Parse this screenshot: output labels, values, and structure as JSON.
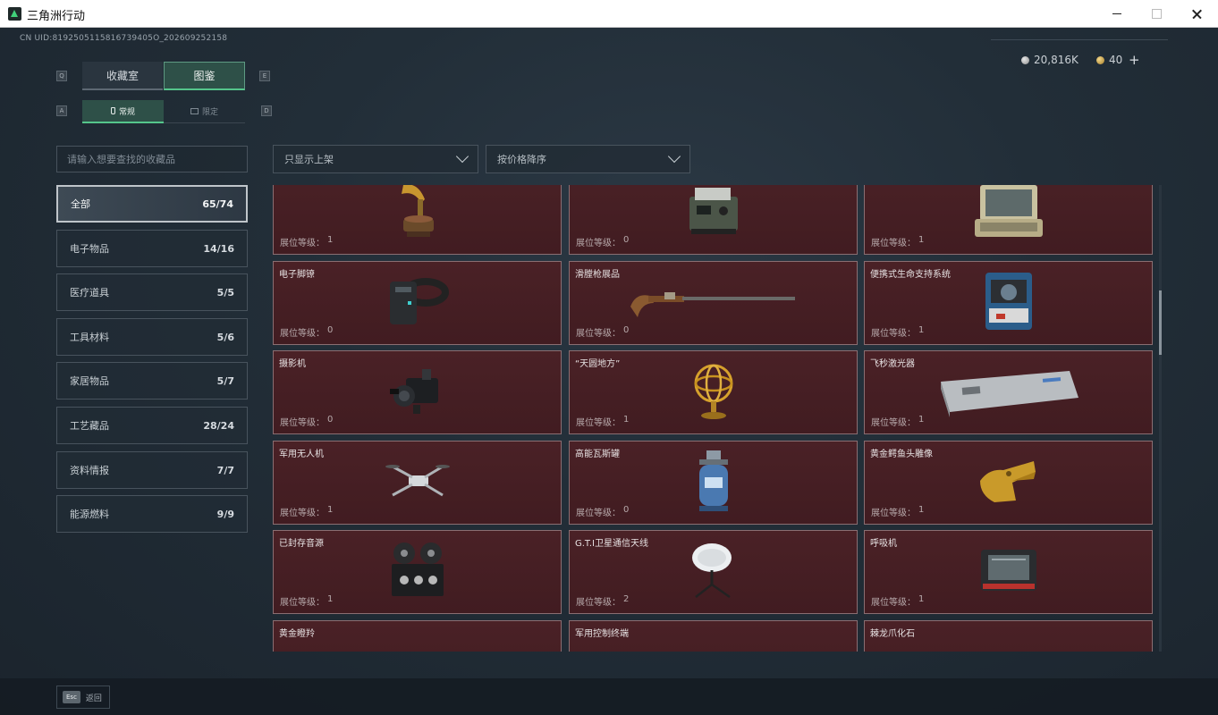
{
  "window": {
    "title": "三角洲行动"
  },
  "header": {
    "uid": "CN UID:8192505115816739405O_202609252158",
    "currency": [
      {
        "icon": "silver-coin-icon",
        "amount": "20,816K"
      },
      {
        "icon": "gold-coin-icon",
        "amount": "40"
      }
    ],
    "add_label": "+"
  },
  "tabs": {
    "primary": [
      {
        "label": "收藏室",
        "active": false
      },
      {
        "label": "图鉴",
        "active": true
      }
    ],
    "secondary": [
      {
        "label": "常规",
        "icon": "bottle-icon",
        "active": true
      },
      {
        "label": "限定",
        "icon": "picture-icon",
        "active": false
      }
    ],
    "keys": {
      "prev_primary": "Q",
      "next_primary": "E",
      "prev_secondary": "A",
      "next_secondary": "D"
    }
  },
  "search": {
    "placeholder": "请输入想要查找的收藏品"
  },
  "filters": {
    "shelf": "只显示上架",
    "sort": "按价格降序"
  },
  "categories": [
    {
      "label": "全部",
      "count": "65/74",
      "active": true
    },
    {
      "label": "电子物品",
      "count": "14/16"
    },
    {
      "label": "医疗道具",
      "count": "5/5"
    },
    {
      "label": "工具材料",
      "count": "5/6"
    },
    {
      "label": "家居物品",
      "count": "5/7"
    },
    {
      "label": "工艺藏品",
      "count": "28/24"
    },
    {
      "label": "资料情报",
      "count": "7/7"
    },
    {
      "label": "能源燃料",
      "count": "9/9"
    }
  ],
  "level_label": "展位等级：",
  "items": [
    {
      "name": "",
      "level": "1",
      "icon": "gramophone-icon"
    },
    {
      "name": "",
      "level": "0",
      "icon": "military-radio-icon"
    },
    {
      "name": "",
      "level": "1",
      "icon": "field-computer-icon"
    },
    {
      "name": "电子脚镣",
      "level": "0",
      "icon": "ankle-monitor-icon"
    },
    {
      "name": "滑膛枪展品",
      "level": "0",
      "icon": "musket-icon"
    },
    {
      "name": "便携式生命支持系统",
      "level": "1",
      "icon": "life-support-icon"
    },
    {
      "name": "摄影机",
      "level": "0",
      "icon": "camera-icon"
    },
    {
      "name": "“天圆地方”",
      "level": "1",
      "icon": "armillary-sphere-icon"
    },
    {
      "name": "飞秒激光器",
      "level": "1",
      "icon": "laser-device-icon"
    },
    {
      "name": "军用无人机",
      "level": "1",
      "icon": "drone-icon"
    },
    {
      "name": "高能瓦斯罐",
      "level": "0",
      "icon": "gas-canister-icon"
    },
    {
      "name": "黄金鳄鱼头雕像",
      "level": "1",
      "icon": "golden-crocodile-icon"
    },
    {
      "name": "已封存音源",
      "level": "1",
      "icon": "reel-recorder-icon"
    },
    {
      "name": "G.T.I卫星通信天线",
      "level": "2",
      "icon": "satellite-antenna-icon"
    },
    {
      "name": "呼吸机",
      "level": "1",
      "icon": "ventilator-icon"
    },
    {
      "name": "黄金瞪羚",
      "level": "",
      "icon": "golden-gazelle-icon"
    },
    {
      "name": "军用控制终端",
      "level": "",
      "icon": "control-terminal-icon"
    },
    {
      "name": "棘龙爪化石",
      "level": "",
      "icon": "claw-fossil-icon"
    }
  ],
  "bottom": {
    "esc_key": "Esc",
    "back_label": "返回"
  }
}
